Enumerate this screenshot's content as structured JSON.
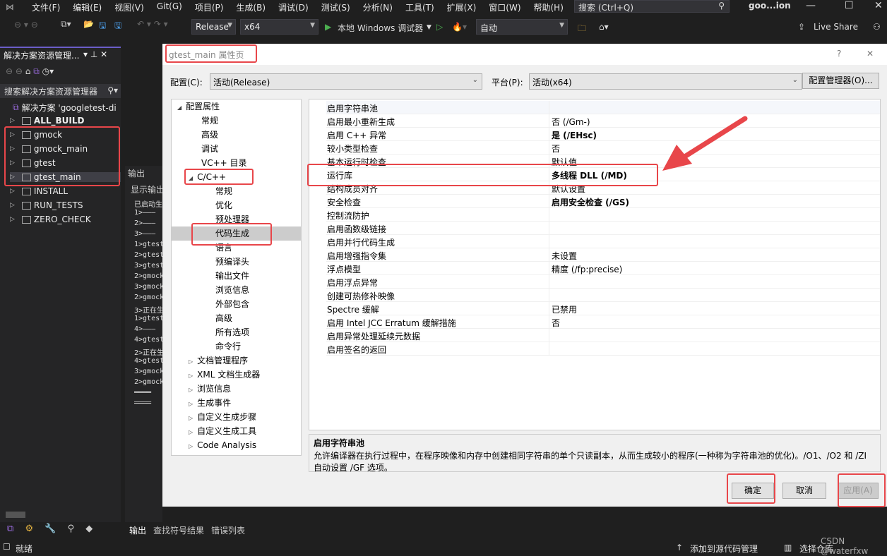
{
  "menu": [
    "文件(F)",
    "编辑(E)",
    "视图(V)",
    "Git(G)",
    "项目(P)",
    "生成(B)",
    "调试(D)",
    "测试(S)",
    "分析(N)",
    "工具(T)",
    "扩展(X)",
    "窗口(W)",
    "帮助(H)"
  ],
  "search_placeholder": "搜索 (Ctrl+Q)",
  "window_title": "goo...ion",
  "toolbar": {
    "config": "Release",
    "platform": "x64",
    "run": "本地 Windows 调试器",
    "auto": "自动",
    "live_share": "Live Share"
  },
  "solution_explorer": {
    "title": "解决方案资源管理...",
    "search": "搜索解决方案资源管理器",
    "items": [
      {
        "label": "解决方案 'googletest-di"
      },
      {
        "label": "ALL_BUILD"
      },
      {
        "label": "gmock"
      },
      {
        "label": "gmock_main"
      },
      {
        "label": "gtest"
      },
      {
        "label": "gtest_main"
      },
      {
        "label": "INSTALL"
      },
      {
        "label": "RUN_TESTS"
      },
      {
        "label": "ZERO_CHECK"
      }
    ]
  },
  "output": {
    "title": "输出",
    "show": "显示输出",
    "lines": [
      "已启动生",
      "1>———",
      "2>———",
      "3>———",
      "1>gtest",
      "2>gtest",
      "3>gtest",
      "2>gmock",
      "3>gmock",
      "2>gmock",
      "3>正在生",
      "1>gtest",
      "4>———",
      "4>gtest",
      "2>正在生",
      "4>gtest",
      "3>gmock",
      "2>gmock",
      "════",
      "════"
    ]
  },
  "dialog": {
    "title": "gtest_main 属性页",
    "help": "?",
    "close": "✕",
    "config_label": "配置(C):",
    "config_value": "活动(Release)",
    "platform_label": "平台(P):",
    "platform_value": "活动(x64)",
    "config_manager": "配置管理器(O)...",
    "tree": [
      {
        "label": "配置属性",
        "level": 0,
        "expand": "◢"
      },
      {
        "label": "常规",
        "level": 1
      },
      {
        "label": "高级",
        "level": 1
      },
      {
        "label": "调试",
        "level": 1
      },
      {
        "label": "VC++ 目录",
        "level": 1
      },
      {
        "label": "C/C++",
        "level": 1,
        "expand": "◢"
      },
      {
        "label": "常规",
        "level": 2
      },
      {
        "label": "优化",
        "level": 2
      },
      {
        "label": "预处理器",
        "level": 2
      },
      {
        "label": "代码生成",
        "level": 2,
        "selected": true
      },
      {
        "label": "语言",
        "level": 2
      },
      {
        "label": "预编译头",
        "level": 2
      },
      {
        "label": "输出文件",
        "level": 2
      },
      {
        "label": "浏览信息",
        "level": 2
      },
      {
        "label": "外部包含",
        "level": 2
      },
      {
        "label": "高级",
        "level": 2
      },
      {
        "label": "所有选项",
        "level": 2
      },
      {
        "label": "命令行",
        "level": 2
      },
      {
        "label": "文档管理程序",
        "level": 1,
        "expand": "▷"
      },
      {
        "label": "XML 文档生成器",
        "level": 1,
        "expand": "▷"
      },
      {
        "label": "浏览信息",
        "level": 1,
        "expand": "▷"
      },
      {
        "label": "生成事件",
        "level": 1,
        "expand": "▷"
      },
      {
        "label": "自定义生成步骤",
        "level": 1,
        "expand": "▷"
      },
      {
        "label": "自定义生成工具",
        "level": 1,
        "expand": "▷"
      },
      {
        "label": "Code Analysis",
        "level": 1,
        "expand": "▷"
      }
    ],
    "properties": [
      {
        "name": "启用字符串池",
        "value": ""
      },
      {
        "name": "启用最小重新生成",
        "value": "否 (/Gm-)"
      },
      {
        "name": "启用 C++ 异常",
        "value": "是 (/EHsc)",
        "bold": true
      },
      {
        "name": "较小类型检查",
        "value": "否"
      },
      {
        "name": "基本运行时检查",
        "value": "默认值"
      },
      {
        "name": "运行库",
        "value": "多线程 DLL (/MD)",
        "bold": true
      },
      {
        "name": "结构成员对齐",
        "value": "默认设置"
      },
      {
        "name": "安全检查",
        "value": "启用安全检查 (/GS)",
        "bold": true
      },
      {
        "name": "控制流防护",
        "value": ""
      },
      {
        "name": "启用函数级链接",
        "value": ""
      },
      {
        "name": "启用并行代码生成",
        "value": ""
      },
      {
        "name": "启用增强指令集",
        "value": "未设置"
      },
      {
        "name": "浮点模型",
        "value": "精度 (/fp:precise)"
      },
      {
        "name": "启用浮点异常",
        "value": ""
      },
      {
        "name": "创建可热修补映像",
        "value": ""
      },
      {
        "name": "Spectre 缓解",
        "value": "已禁用"
      },
      {
        "name": "启用 Intel JCC Erratum 缓解措施",
        "value": "否"
      },
      {
        "name": "启用异常处理延续元数据",
        "value": ""
      },
      {
        "name": "启用签名的返回",
        "value": ""
      }
    ],
    "desc_title": "启用字符串池",
    "desc_text": "允许编译器在执行过程中，在程序映像和内存中创建相同字符串的单个只读副本，从而生成较小的程序(一种称为字符串池的优化)。/O1、/O2 和 /ZI 自动设置 /GF 选项。",
    "ok": "确定",
    "cancel": "取消",
    "apply": "应用(A)"
  },
  "bottom_tabs": [
    "输出",
    "查找符号结果",
    "错误列表"
  ],
  "status": {
    "ready": "就绪",
    "source_control": "添加到源代码管理",
    "repo": "选择仓库",
    "watermark": "CSDN @waterfxw"
  },
  "annotation_color": "#e8464a"
}
